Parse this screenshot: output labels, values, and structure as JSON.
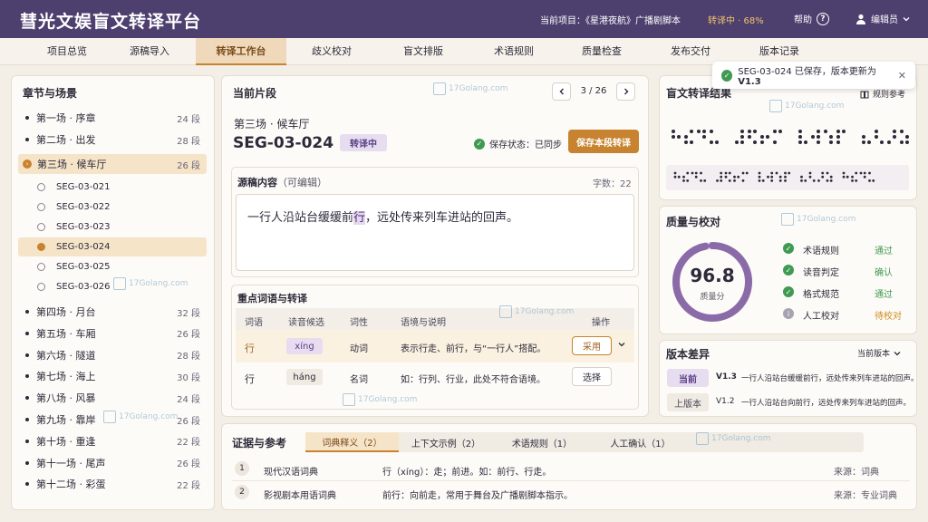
{
  "app": {
    "title": "彗光文娱盲文转译平台",
    "project": "当前项目：《星港夜航》广播剧脚本",
    "status": "转译中 · 68%",
    "help": "帮助",
    "user": "编辑员"
  },
  "nav": [
    "项目总览",
    "源稿导入",
    "转译工作台",
    "歧义校对",
    "盲文排版",
    "术语规则",
    "质量检查",
    "发布交付",
    "版本记录"
  ],
  "nav_active": 2,
  "left": {
    "title": "章节与场景",
    "scenes_top": [
      {
        "label": "第一场 · 序章",
        "count": "24 段"
      },
      {
        "label": "第二场 · 出发",
        "count": "28 段"
      },
      {
        "label": "第三场 · 候车厅",
        "count": "26 段"
      }
    ],
    "segments": [
      "SEG-03-021",
      "SEG-03-022",
      "SEG-03-023",
      "SEG-03-024",
      "SEG-03-025",
      "SEG-03-026"
    ],
    "scenes_bottom": [
      {
        "label": "第四场 · 月台",
        "count": "32 段"
      },
      {
        "label": "第五场 · 车厢",
        "count": "26 段"
      },
      {
        "label": "第六场 · 隧道",
        "count": "28 段"
      },
      {
        "label": "第七场 · 海上",
        "count": "30 段"
      },
      {
        "label": "第八场 · 风暴",
        "count": "24 段"
      },
      {
        "label": "第九场 · 靠岸",
        "count": "26 段"
      },
      {
        "label": "第十场 · 重逢",
        "count": "22 段"
      },
      {
        "label": "第十一场 · 尾声",
        "count": "26 段"
      },
      {
        "label": "第十二场 · 彩蛋",
        "count": "22 段"
      }
    ]
  },
  "center": {
    "title": "当前片段",
    "pager": "3 / 26",
    "scene": "第三场 · 候车厅",
    "seg_id": "SEG-03-024",
    "badge": "转译中",
    "save_state": "保存状态：已同步",
    "save_btn": "保存本段转译",
    "source_title": "源稿内容",
    "source_note": "（可编辑）",
    "word_count": "字数：22",
    "source_before": "一行人沿站台缓缓前",
    "source_highlight": "行",
    "source_after": "，远处传来列车进站的回声。",
    "terms_title": "重点词语与转译",
    "terms_headers": [
      "词语",
      "读音候选",
      "词性",
      "语境与说明",
      "操作"
    ],
    "terms": [
      {
        "word": "行",
        "pinyin": "xíng",
        "pos": "动词",
        "note": "表示行走、前行，与“一行人”搭配。",
        "action": "采用"
      },
      {
        "word": "行",
        "pinyin": "háng",
        "pos": "名词",
        "note": "如：行列、行业，此处不符合语境。",
        "action": "选择"
      }
    ]
  },
  "evidence": {
    "title": "证据与参考",
    "tabs": [
      "词典释义（2）",
      "上下文示例（2）",
      "术语规则（1）",
      "人工确认（1）"
    ],
    "rows": [
      {
        "num": "1",
        "name": "现代汉语词典",
        "text": "行（xíng）：走；前进。如：前行、行走。",
        "source": "来源：词典"
      },
      {
        "num": "2",
        "name": "影视剧本用语词典",
        "text": "前行：向前走，常用于舞台及广播剧脚本指示。",
        "source": "来源：专业词典"
      }
    ]
  },
  "right": {
    "braille_title": "盲文转译结果",
    "rules_link": "规则参考",
    "toast": "SEG-03-024 已保存，版本更新为 ",
    "toast_version": "V1.3",
    "quality_title": "质量与校对",
    "score": "96.8",
    "score_label": "质量分",
    "score_pct": 0.968,
    "checks": [
      {
        "label": "术语规则",
        "result": "通过",
        "ok": true
      },
      {
        "label": "读音判定",
        "result": "确认",
        "ok": true
      },
      {
        "label": "格式规范",
        "result": "通过",
        "ok": true
      },
      {
        "label": "人工校对",
        "result": "待校对",
        "ok": false
      }
    ],
    "diff_title": "版本差异",
    "diff_select": "当前版本",
    "diff": [
      {
        "tag": "当前",
        "ver": "V1.3",
        "text": "一行人沿站台缓缓前行，远处传来列车进站的回声。"
      },
      {
        "tag": "上版本",
        "ver": "V1.2",
        "text": "一行人沿站台向前行，远处传来列车进站的回声。"
      }
    ]
  },
  "watermark": "17Golang.com",
  "colors": {
    "header": "#4d3f6e",
    "accent": "#c7832f",
    "purple": "#8b6aa8",
    "ok": "#3f9a52",
    "warn": "#d08a1e"
  }
}
